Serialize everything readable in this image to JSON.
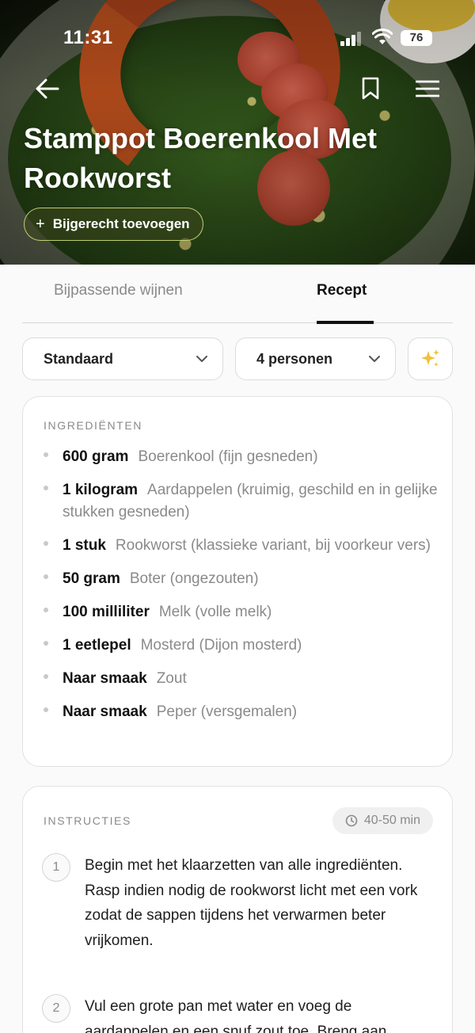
{
  "status_bar": {
    "time": "11:31",
    "battery": "76"
  },
  "hero": {
    "title": "Stamppot Boerenkool Met Rookworst",
    "add_side_label": "Bijgerecht toevoegen"
  },
  "tabs": [
    {
      "label": "Bijpassende wijnen",
      "active": false
    },
    {
      "label": "Recept",
      "active": true
    }
  ],
  "controls": {
    "style_select": "Standaard",
    "people_select": "4 personen"
  },
  "ingredients": {
    "heading": "INGREDIËNTEN",
    "items": [
      {
        "qty": "600 gram",
        "name": "Boerenkool (fijn gesneden)"
      },
      {
        "qty": "1 kilogram",
        "name": "Aardappelen (kruimig, geschild en in gelijke stukken gesneden)"
      },
      {
        "qty": "1 stuk",
        "name": "Rookworst (klassieke variant, bij voorkeur vers)"
      },
      {
        "qty": "50 gram",
        "name": "Boter (ongezouten)"
      },
      {
        "qty": "100 milliliter",
        "name": "Melk (volle melk)"
      },
      {
        "qty": "1 eetlepel",
        "name": "Mosterd (Dijon mosterd)"
      },
      {
        "qty": "Naar smaak",
        "name": "Zout"
      },
      {
        "qty": "Naar smaak",
        "name": "Peper (versgemalen)"
      }
    ]
  },
  "instructions": {
    "heading": "INSTRUCTIES",
    "duration": "40-50 min",
    "steps": [
      {
        "num": "1",
        "text": "Begin met het klaarzetten van alle ingrediënten. Rasp indien nodig de rookworst licht met een vork zodat de sappen tijdens het verwarmen beter vrijkomen."
      },
      {
        "num": "2",
        "text": "Vul een grote pan met water en voeg de aardappelen en een snuf zout toe. Breng aan"
      }
    ]
  },
  "colors": {
    "accent": "#111111",
    "muted_text": "#8a8a8a",
    "side_button_border": "#d6e882",
    "ai_icon": "#f0c23a"
  }
}
